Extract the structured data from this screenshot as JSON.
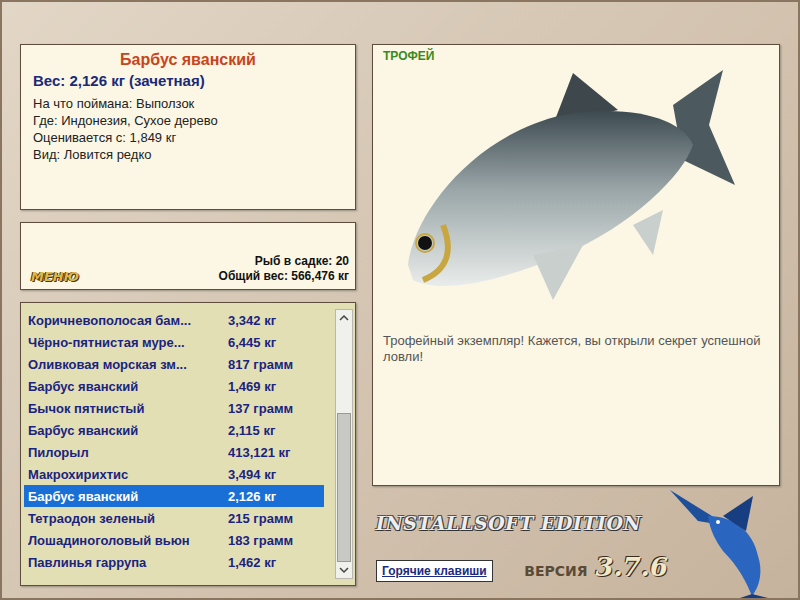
{
  "fish_card": {
    "title": "Барбус яванский",
    "weight": "Вес: 2,126 кг (зачетная)",
    "details": [
      "На что поймана: Выползок",
      "Где: Индонезия, Сухое дерево",
      "Оценивается с: 1,849 кг",
      "Вид: Ловится редко"
    ]
  },
  "keepnet": {
    "menu_button": "МЕНЮ",
    "count": "Рыб в садке: 20",
    "total": "Общий вес: 566,476 кг"
  },
  "catch_list": [
    {
      "name": "Коричневополосая бам...",
      "weight": "3,342 кг",
      "selected": false
    },
    {
      "name": "Чёрно-пятнистая муре...",
      "weight": "6,445 кг",
      "selected": false
    },
    {
      "name": "Оливковая морская зм...",
      "weight": "817 грамм",
      "selected": false
    },
    {
      "name": "Барбус яванский",
      "weight": "1,469 кг",
      "selected": false
    },
    {
      "name": "Бычок пятнистый",
      "weight": "137 грамм",
      "selected": false
    },
    {
      "name": "Барбус яванский",
      "weight": "2,115 кг",
      "selected": false
    },
    {
      "name": "Пилорыл",
      "weight": "413,121 кг",
      "selected": false
    },
    {
      "name": "Макрохирихтис",
      "weight": "3,494 кг",
      "selected": false
    },
    {
      "name": "Барбус яванский",
      "weight": "2,126 кг",
      "selected": true
    },
    {
      "name": "Тетраодон зеленый",
      "weight": "215 грамм",
      "selected": false
    },
    {
      "name": "Лошадиноголовый вьюн",
      "weight": "183 грамм",
      "selected": false
    },
    {
      "name": "Павлинья гаррупа",
      "weight": "1,462 кг",
      "selected": false
    }
  ],
  "scrollbar": {
    "level": 1,
    "thumb_share": 0.63
  },
  "trophy": {
    "badge": "ТРОФЕЙ",
    "message": "Трофейный экземпляр! Кажется, вы открыли секрет успешной ловли!"
  },
  "footer": {
    "edition": "INSTALLSOFT EDITION",
    "version_label": "ВЕРСИЯ",
    "version": "3.7.6",
    "hotkeys_button": "Горячие клавиши"
  }
}
